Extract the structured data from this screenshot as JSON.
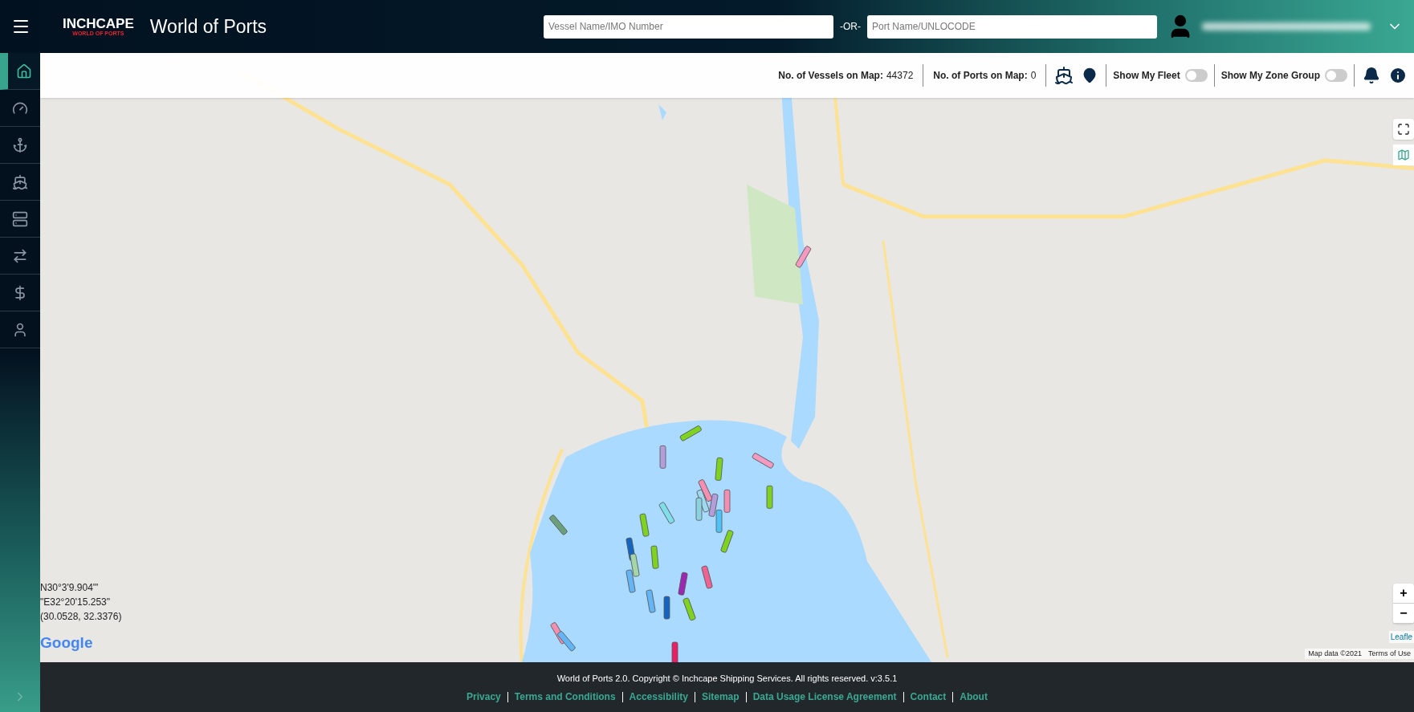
{
  "header": {
    "logo": {
      "name": "INCHCAPE",
      "tagline": "WORLD OF PORTS"
    },
    "title": "World of Ports",
    "vessel_search": {
      "placeholder": "Vessel Name/IMO Number"
    },
    "separator": "-OR-",
    "port_search": {
      "placeholder": "Port Name/UNLOCODE"
    }
  },
  "sidebar": {
    "items": [
      {
        "kind": "home",
        "selected": true
      },
      {
        "kind": "gauge",
        "selected": false
      },
      {
        "kind": "anchor",
        "selected": false
      },
      {
        "kind": "ship",
        "selected": false
      },
      {
        "kind": "list",
        "selected": false
      },
      {
        "kind": "transfer",
        "selected": false
      },
      {
        "kind": "dollar",
        "selected": false
      },
      {
        "kind": "user",
        "selected": false
      }
    ]
  },
  "toolbar": {
    "stats": [
      {
        "label": "No. of Vessels on Map:",
        "value": "44372"
      },
      {
        "label": "No. of Ports on Map:",
        "value": "0"
      }
    ],
    "toggles": [
      {
        "label": "Show My Fleet",
        "on": false
      },
      {
        "label": "Show My Zone Group",
        "on": false
      }
    ]
  },
  "map": {
    "coordinates": [
      "N30°3'9.904'\"",
      "\"E32°20'15.253\"",
      "(30.0528, 32.3376)"
    ],
    "google": "Google",
    "zoom_controls": [
      "+",
      "−"
    ],
    "leaflet": "Leafle",
    "map_data": "Map data ©2021",
    "terms": "Terms of Use"
  },
  "footer": {
    "copyright": "World of Ports 2.0. Copyright © Inchcape Shipping Services. All rights reserved. v:3.5.1",
    "links": [
      "Privacy",
      "Terms and Conditions",
      "Accessibility",
      "Sitemap",
      "Data Usage License Agreement",
      "Contact",
      "About"
    ]
  }
}
